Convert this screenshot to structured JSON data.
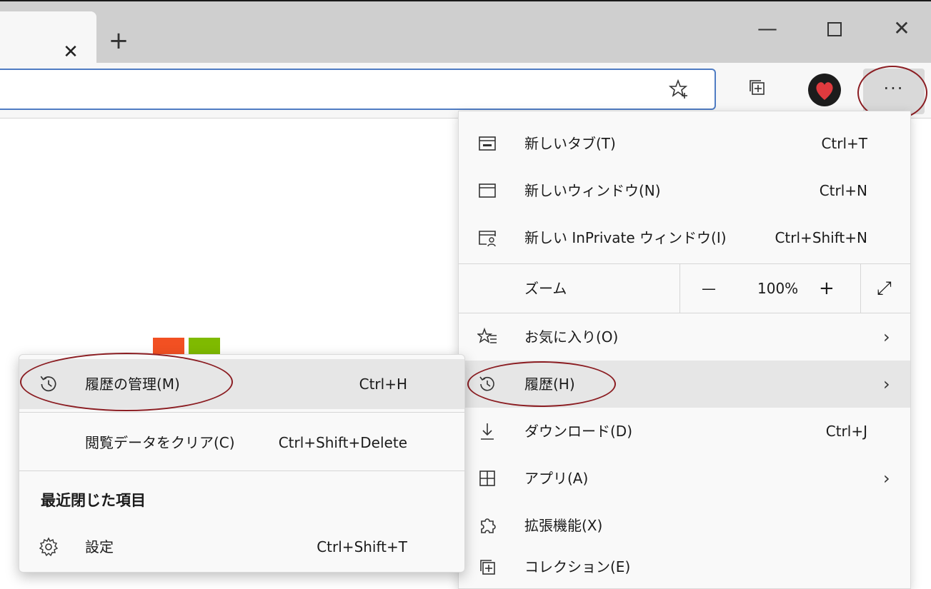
{
  "titlebar": {
    "tab_close": "✕",
    "new_tab": "+",
    "minimize": "—",
    "close": "✕"
  },
  "toolbar": {
    "favorite_icon": "star-plus-icon",
    "more": "···"
  },
  "menu": {
    "items": [
      {
        "label": "新しいタブ(T)",
        "shortcut": "Ctrl+T",
        "icon": "new-tab-icon"
      },
      {
        "label": "新しいウィンドウ(N)",
        "shortcut": "Ctrl+N",
        "icon": "window-icon"
      },
      {
        "label": "新しい InPrivate ウィンドウ(I)",
        "shortcut": "Ctrl+Shift+N",
        "icon": "inprivate-icon"
      }
    ],
    "zoom": {
      "label": "ズーム",
      "minus": "—",
      "value": "100%",
      "plus": "+",
      "fullscreen": "⤢"
    },
    "items2": [
      {
        "label": "お気に入り(O)",
        "arrow": "›",
        "icon": "favorites-icon"
      },
      {
        "label": "履歴(H)",
        "arrow": "›",
        "icon": "history-icon"
      },
      {
        "label": "ダウンロード(D)",
        "shortcut": "Ctrl+J",
        "icon": "download-icon"
      },
      {
        "label": "アプリ(A)",
        "arrow": "›",
        "icon": "apps-icon"
      },
      {
        "label": "拡張機能(X)",
        "icon": "extensions-icon"
      },
      {
        "label": "コレクション(E)",
        "icon": "collections-icon"
      }
    ]
  },
  "submenu": {
    "manage": {
      "label": "履歴の管理(M)",
      "shortcut": "Ctrl+H"
    },
    "clear": {
      "label": "閲覧データをクリア(C)",
      "shortcut": "Ctrl+Shift+Delete"
    },
    "recent_header": "最近閉じた項目",
    "settings": {
      "label": "設定",
      "shortcut": "Ctrl+Shift+T"
    }
  },
  "colors": {
    "accent": "#4f7cc3",
    "annotation": "#8b1d22",
    "highlight": "#e6e6e6"
  }
}
